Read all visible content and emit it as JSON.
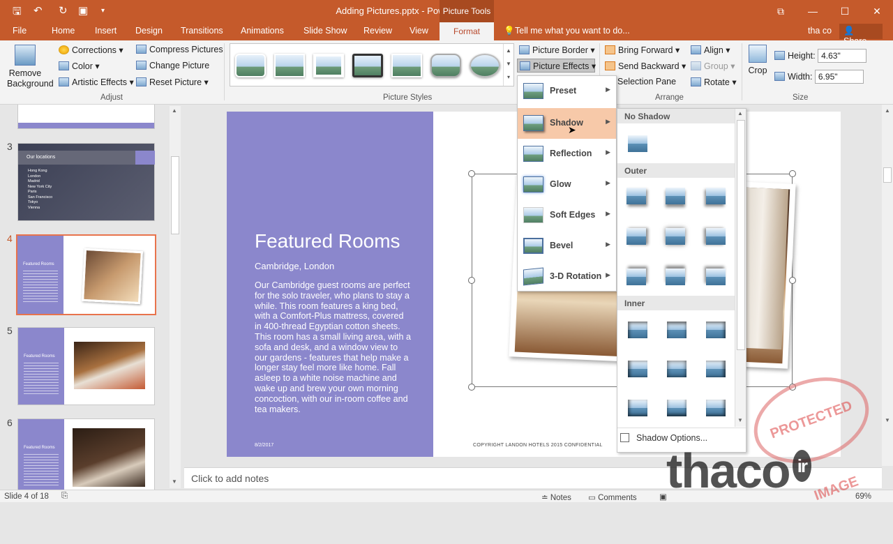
{
  "window": {
    "title": "Adding Pictures.pptx - PowerPoint",
    "context_tab": "Picture Tools",
    "buttons": {
      "restore": "⧉",
      "minimize": "—",
      "maximize": "☐",
      "close": "✕"
    }
  },
  "tabs": [
    "File",
    "Home",
    "Insert",
    "Design",
    "Transitions",
    "Animations",
    "Slide Show",
    "Review",
    "View",
    "Format"
  ],
  "active_tab": "Format",
  "tell_me": "Tell me what you want to do...",
  "user": "tha co",
  "share": "Share",
  "ribbon": {
    "adjust": {
      "remove_background": "Remove Background",
      "corrections": "Corrections",
      "color": "Color",
      "artistic": "Artistic Effects",
      "compress": "Compress Pictures",
      "change": "Change Picture",
      "reset": "Reset Picture",
      "label": "Adjust"
    },
    "styles_label": "Picture Styles",
    "border": "Picture Border",
    "effects": "Picture Effects",
    "arrange": {
      "forward": "Bring Forward",
      "backward": "Send Backward",
      "selection": "Selection Pane",
      "align": "Align",
      "group": "Group",
      "rotate": "Rotate",
      "label": "Arrange"
    },
    "size": {
      "crop": "Crop",
      "height_label": "Height:",
      "height": "4.63\"",
      "width_label": "Width:",
      "width": "6.95\"",
      "label": "Size"
    }
  },
  "slides": {
    "numbers": [
      "3",
      "4",
      "5",
      "6"
    ],
    "thumb3_title": "Our locations",
    "thumb3_items": [
      "Hong Kong",
      "London",
      "Madrid",
      "New York City",
      "Paris",
      "San Francisco",
      "Tokyo",
      "Vienna"
    ],
    "thumb_title": "Featured Rooms"
  },
  "slide": {
    "title": "Featured Rooms",
    "subtitle": "Cambridge, London",
    "body": "Our Cambridge guest rooms are perfect for the solo traveler, who plans to stay a while. This room features a king bed, with a Comfort-Plus mattress, covered in 400-thread Egyptian cotton sheets. This room has a small living area, with a sofa and desk, and a window view to our gardens - features that help make a longer stay feel more like home. Fall asleep to a white noise machine and wake up and brew your own morning concoction, with our in-room coffee and tea makers.",
    "date": "8/2/2017",
    "copyright": "COPYRIGHT LANDON HOTELS 2015 CONFIDENTIAL"
  },
  "effects_menu": [
    "Preset",
    "Shadow",
    "Reflection",
    "Glow",
    "Soft Edges",
    "Bevel",
    "3-D Rotation"
  ],
  "shadow_gallery": {
    "no_shadow": "No Shadow",
    "outer": "Outer",
    "inner": "Inner",
    "options": "Shadow Options..."
  },
  "notes": "Click to add notes",
  "status": {
    "slide": "Slide 4 of 18",
    "notes": "Notes",
    "comments": "Comments",
    "zoom": "69%"
  },
  "watermark": {
    "brand": "thaco",
    "suffix": "ir",
    "stamp": "PROTECTED IMAGE"
  }
}
